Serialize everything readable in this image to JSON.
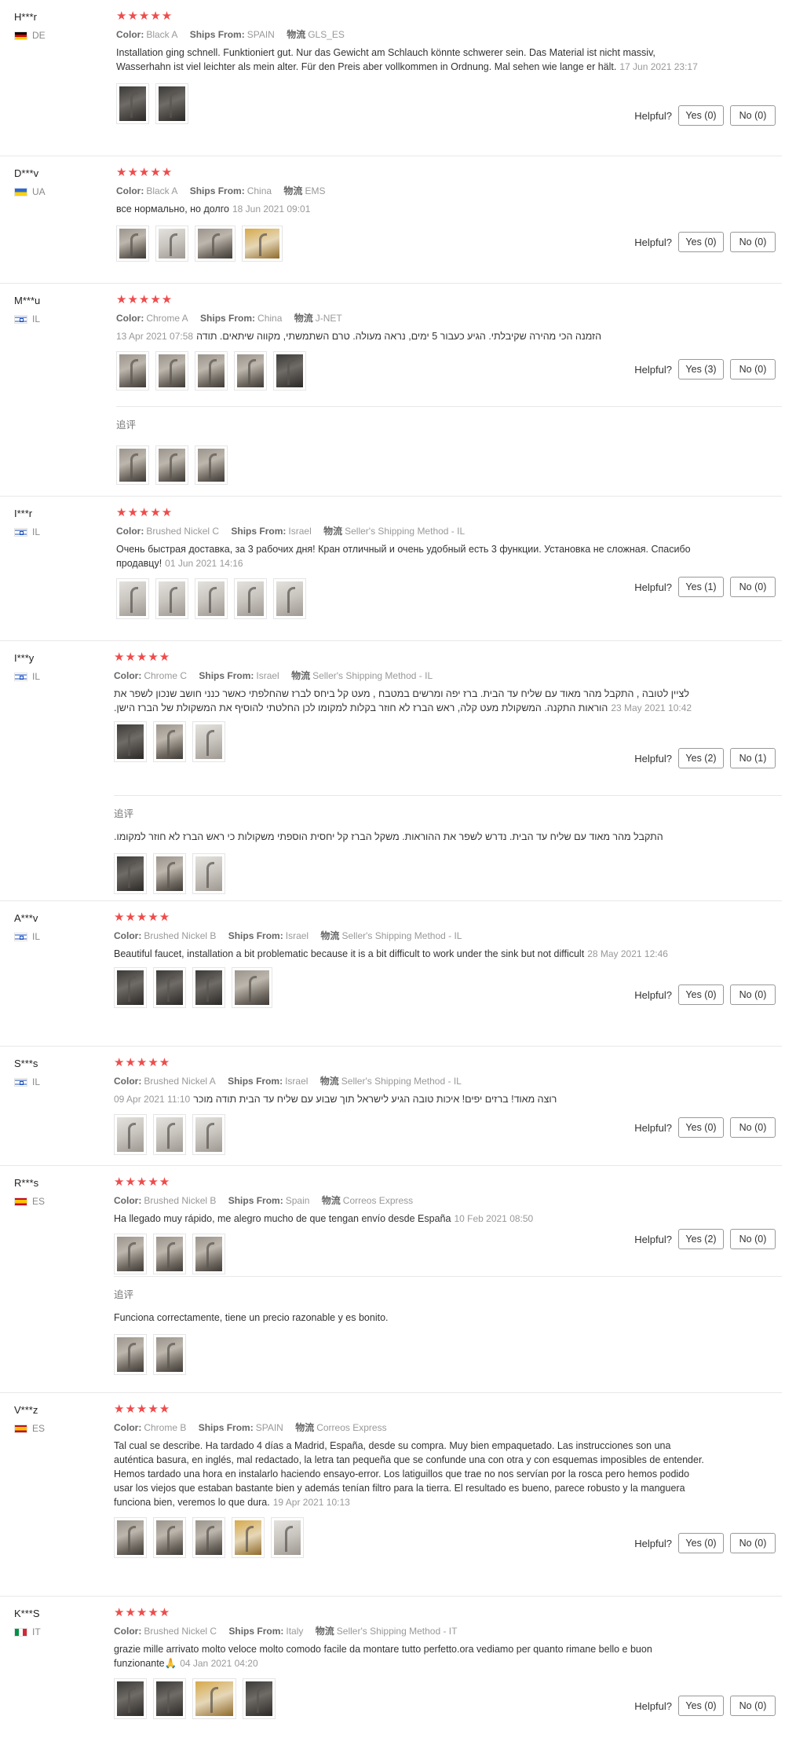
{
  "labels": {
    "color": "Color:",
    "ships_from": "Ships From:",
    "logistics": "物流",
    "helpful": "Helpful?",
    "append": "追评"
  },
  "colors": {
    "star": "#ef4b4b",
    "border": "#e8e8e8"
  },
  "reviews": [
    {
      "user": "H***r",
      "country": "DE",
      "stars": "★★★★★",
      "color": "Black A",
      "ships_from": "SPAIN",
      "logistics": "GLS_ES",
      "text": "Installation ging schnell. Funktioniert gut. Nur das Gewicht am Schlauch könnte schwerer sein. Das Material ist nicht massiv, Wasserhahn ist viel leichter als mein alter. Für den Preis aber vollkommen in Ordnung. Mal sehen wie lange er hält.",
      "date": "17 Jun 2021 23:17",
      "yes": "Yes (0)",
      "no": "No (0)"
    },
    {
      "user": "D***v",
      "country": "UA",
      "stars": "★★★★★",
      "color": "Black A",
      "ships_from": "China",
      "logistics": "EMS",
      "text": "все нормально, но долго",
      "date": "18 Jun 2021 09:01",
      "yes": "Yes (0)",
      "no": "No (0)"
    },
    {
      "user": "M***u",
      "country": "IL",
      "stars": "★★★★★",
      "color": "Chrome A",
      "ships_from": "China",
      "logistics": "J-NET",
      "text": "הזמנה הכי מהירה שקיבלתי. הגיע כעבור 5 ימים, נראה מעולה. טרם השתמשתי, מקווה שיתאים. תודה",
      "date": "13 Apr 2021 07:58",
      "yes": "Yes (3)",
      "no": "No (0)",
      "append_text": ""
    },
    {
      "user": "I***r",
      "country": "IL",
      "stars": "★★★★★",
      "color": "Brushed Nickel C",
      "ships_from": "Israel",
      "logistics": "Seller's Shipping Method - IL",
      "text": "Очень быстрая доставка, за 3 рабочих дня! Кран отличный и очень удобный есть 3 функции. Установка не сложная. Спасибо продавцу!",
      "date": "01 Jun 2021 14:16",
      "yes": "Yes (1)",
      "no": "No (0)"
    },
    {
      "user": "I***y",
      "country": "IL",
      "stars": "★★★★★",
      "color": "Chrome C",
      "ships_from": "Israel",
      "logistics": "Seller's Shipping Method - IL",
      "text": "לציין לטובה , התקבל מהר מאוד עם שליח עד הבית. ברז יפה ומרשים במטבח , מעט קל ביחס לברז שהחלפתי כאשר כנני חושב שנכון לשפר את הוראות התקנה. המשקולת מעט קלה, ראש הברז לא חוזר בקלות למקומו לכן החלטתי להוסיף את המשקולת של הברז הישן.",
      "date": "23 May 2021 10:42",
      "yes": "Yes (2)",
      "no": "No (1)",
      "append_text": "התקבל מהר מאוד עם שליח עד הבית. נדרש לשפר את ההוראות. משקל הברז קל יחסית הוספתי משקולות כי ראש הברז לא חוזר למקומו."
    },
    {
      "user": "A***v",
      "country": "IL",
      "stars": "★★★★★",
      "color": "Brushed Nickel B",
      "ships_from": "Israel",
      "logistics": "Seller's Shipping Method - IL",
      "text": "Beautiful faucet, installation a bit problematic because it is a bit difficult to work under the sink but not difficult",
      "date": "28 May 2021 12:46",
      "yes": "Yes (0)",
      "no": "No (0)"
    },
    {
      "user": "S***s",
      "country": "IL",
      "stars": "★★★★★",
      "color": "Brushed Nickel A",
      "ships_from": "Israel",
      "logistics": "Seller's Shipping Method - IL",
      "text": "רוצה מאוד! ברזים יפים! איכות טובה הגיע לישראל תוך שבוע עם שליח עד הבית תודה מוכר",
      "date": "09 Apr 2021 11:10",
      "yes": "Yes (0)",
      "no": "No (0)"
    },
    {
      "user": "R***s",
      "country": "ES",
      "stars": "★★★★★",
      "color": "Brushed Nickel B",
      "ships_from": "Spain",
      "logistics": "Correos Express",
      "text": "Ha llegado muy rápido, me alegro mucho de que tengan envío desde España",
      "date": "10 Feb 2021 08:50",
      "yes": "Yes (2)",
      "no": "No (0)",
      "append_text": "Funciona correctamente, tiene un precio razonable y es bonito."
    },
    {
      "user": "V***z",
      "country": "ES",
      "stars": "★★★★★",
      "color": "Chrome B",
      "ships_from": "SPAIN",
      "logistics": "Correos Express",
      "text": "Tal cual se describe. Ha tardado 4 días a Madrid, España, desde su compra. Muy bien empaquetado. Las instrucciones son una auténtica basura, en inglés, mal redactado, la letra tan pequeña que se confunde una con otra y con esquemas imposibles de entender. Hemos tardado una hora en instalarlo haciendo ensayo-error. Los latiguillos que trae no nos servían por la rosca pero hemos podido usar los viejos que estaban bastante bien y además tenían filtro para la tierra. El resultado es bueno, parece robusto y la manguera funciona bien, veremos lo que dura.",
      "date": "19 Apr 2021 10:13",
      "yes": "Yes (0)",
      "no": "No (0)"
    },
    {
      "user": "K***S",
      "country": "IT",
      "stars": "★★★★★",
      "color": "Brushed Nickel C",
      "ships_from": "Italy",
      "logistics": "Seller's Shipping Method - IT",
      "text": "grazie mille arrivato molto veloce molto comodo facile da montare tutto perfetto.ora vediamo per quanto rimane bello e buon funzionante🙏",
      "date": "04 Jan 2021 04:20",
      "yes": "Yes (0)",
      "no": "No (0)"
    }
  ]
}
